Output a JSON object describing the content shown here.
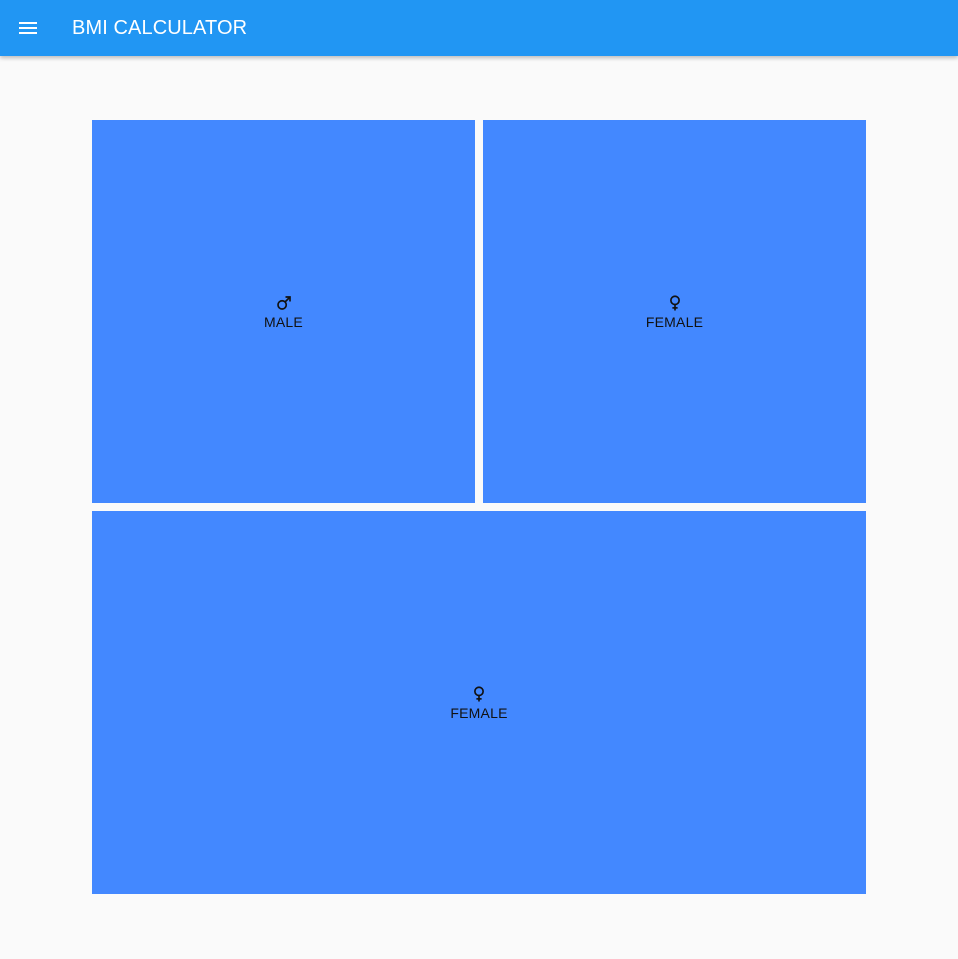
{
  "appbar": {
    "title": "BMI CALCULATOR",
    "menu_icon": "menu-icon",
    "color": "#2196f3"
  },
  "cards": {
    "male": {
      "label": "MALE",
      "icon": "male-icon"
    },
    "female": {
      "label": "FEMALE",
      "icon": "female-icon"
    },
    "bottom": {
      "label": "FEMALE",
      "icon": "female-icon"
    },
    "color": "#4388ff"
  }
}
